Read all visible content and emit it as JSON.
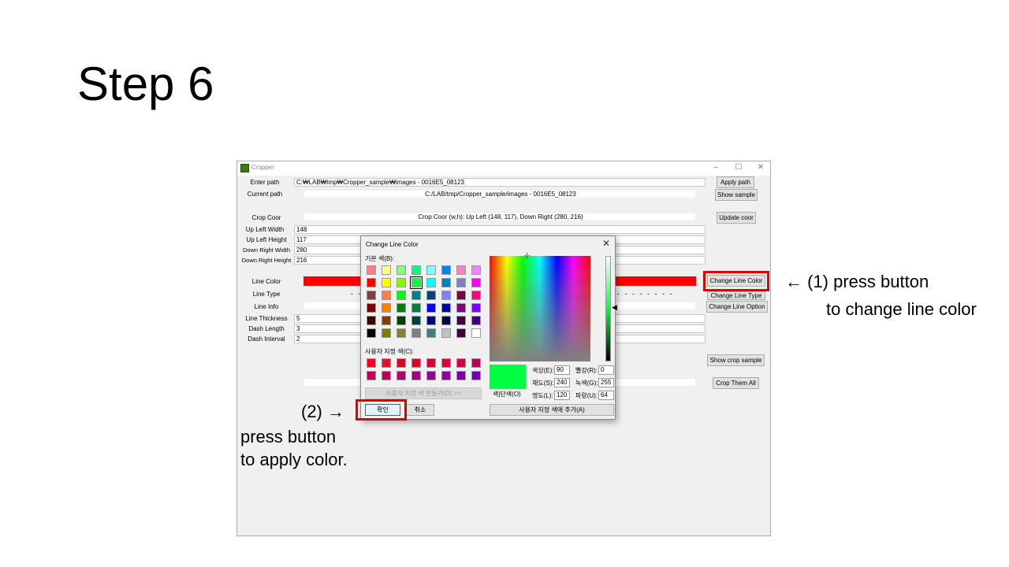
{
  "slide": {
    "title": "Step 6",
    "annotation1_line1": "← (1) press button",
    "annotation1_line2": "to change line color",
    "annotation2_arrow": "(2) →",
    "annotation2_line1": "press button",
    "annotation2_line2": "to apply color."
  },
  "window": {
    "title": "Cropper",
    "controls": {
      "minimize": "–",
      "maximize": "☐",
      "close": "✕"
    },
    "enter_path_label": "Enter path",
    "enter_path_value": "C:₩LAB₩tmp₩Cropper_sample₩images - 0016E5_08123",
    "apply_path_button": "Apply path",
    "current_path_label": "Current path",
    "current_path_value": "C:/LAB/tmp/Cropper_sample/images - 0016E5_08123",
    "show_sample_button": "Show sample",
    "crop_coor_label": "Crop Coor",
    "crop_coor_value": "Crop Coor (w,h): Up Left (148, 117), Down Right (280, 216)",
    "update_coor_button": "Update coor",
    "up_left_width_label": "Up Left Width",
    "up_left_width_value": "148",
    "up_left_height_label": "Up Left Height",
    "up_left_height_value": "117",
    "down_right_width_label": "Down Right Width",
    "down_right_width_value": "280",
    "down_right_height_label": "Down Right Height",
    "down_right_height_value": "216",
    "line_color_label": "Line Color",
    "line_color": "#ff0000",
    "change_line_color_button": "Change Line Color",
    "line_type_label": "Line Type",
    "line_type_dashes": "- - - - - - - -",
    "change_line_type_button": "Change Line Type",
    "line_info_label": "Line Info",
    "change_line_option_button": "Change Line Option",
    "line_thickness_label": "Line Thickness",
    "line_thickness_value": "5",
    "dash_length_label": "Dash Length",
    "dash_length_value": "3",
    "dash_interval_label": "Dash Interval",
    "dash_interval_value": "2",
    "show_crop_sample_button": "Show crop sample",
    "crop_them_all_button": "Crop Them All"
  },
  "dialog": {
    "title": "Change Line Color",
    "close": "✕",
    "basic_colors_label": "기본 색(B):",
    "custom_colors_label": "사용자 지정 색(C):",
    "define_custom_button": "사용자 지정 색 만들기(D) >>",
    "ok_button": "확인",
    "cancel_button": "취소",
    "color_solid_label": "색|단색(O)",
    "hue_label": "색상(E):",
    "hue_value": "90",
    "sat_label": "채도(S):",
    "sat_value": "240",
    "lum_label": "명도(L):",
    "lum_value": "120",
    "red_label": "빨강(R):",
    "red_value": "0",
    "green_label": "녹색(G):",
    "green_value": "255",
    "blue_label": "파랑(U):",
    "blue_value": "64",
    "add_custom_button": "사용자 지정 색에 추가(A)",
    "selected_color": "#00ff40",
    "basic_colors": [
      [
        "#ff8080",
        "#ffff80",
        "#80ff80",
        "#00ff80",
        "#80ffff",
        "#0080ff",
        "#ff80c0",
        "#ff80ff"
      ],
      [
        "#ff0000",
        "#ffff00",
        "#80ff00",
        "#00ff40",
        "#00ffff",
        "#0080c0",
        "#8080c0",
        "#ff00ff"
      ],
      [
        "#804040",
        "#ff8040",
        "#00ff00",
        "#008080",
        "#004080",
        "#8080ff",
        "#800040",
        "#ff0080"
      ],
      [
        "#800000",
        "#ff8000",
        "#008000",
        "#008040",
        "#0000ff",
        "#0000a0",
        "#800080",
        "#8000ff"
      ],
      [
        "#400000",
        "#804000",
        "#004000",
        "#004040",
        "#000080",
        "#000040",
        "#400040",
        "#400080"
      ],
      [
        "#000000",
        "#808000",
        "#808040",
        "#808080",
        "#408080",
        "#c0c0c0",
        "#400040",
        "#ffffff"
      ]
    ],
    "selected_swatch": "1-3",
    "custom_colors": [
      [
        "#ff0020",
        "#ea0f28",
        "#e00020",
        "#e8002a",
        "#d80030",
        "#e0003a",
        "#d40040",
        "#c00050"
      ],
      [
        "#c0005a",
        "#b80060",
        "#b00070",
        "#a00080",
        "#9a0088",
        "#90009a",
        "#8000a0",
        "#7000b0"
      ]
    ]
  }
}
